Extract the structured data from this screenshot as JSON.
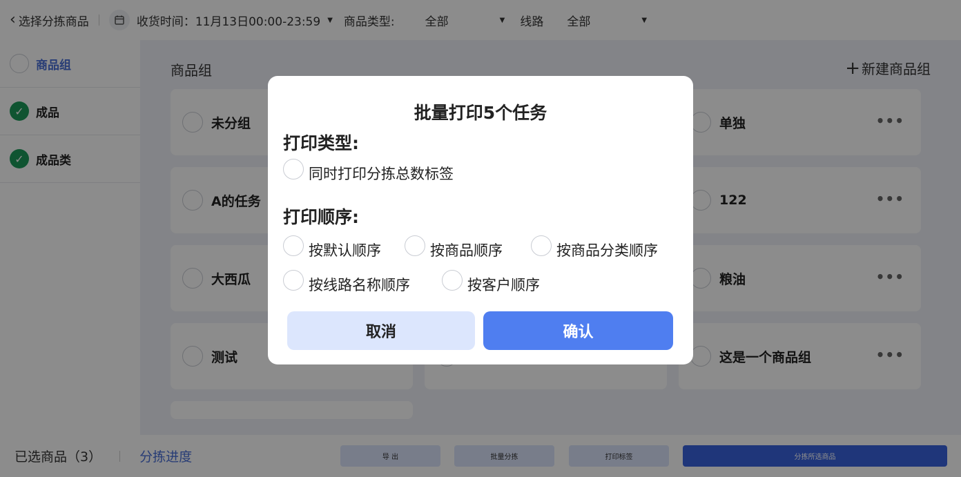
{
  "topbar": {
    "back_label": "选择分拣商品",
    "time_label": "收货时间：",
    "time_value": "11月13日00:00-23:59",
    "type_label": "商品类型:",
    "type_value": "全部",
    "route_label": "线路",
    "route_value": "全部"
  },
  "sidebar": {
    "items": [
      {
        "label": "商品组",
        "state": "unchecked",
        "active": true
      },
      {
        "label": "成品",
        "state": "checked",
        "active": false
      },
      {
        "label": "成品类",
        "state": "checked",
        "active": false
      }
    ]
  },
  "main": {
    "title": "商品组",
    "new_group_label": "新建商品组",
    "cards": [
      {
        "name": "未分组"
      },
      {
        "name": ""
      },
      {
        "name": "单独"
      },
      {
        "name": "A的任务"
      },
      {
        "name": ""
      },
      {
        "name": "122"
      },
      {
        "name": "大西瓜"
      },
      {
        "name": ""
      },
      {
        "name": "粮油"
      },
      {
        "name": "测试"
      },
      {
        "name": ""
      },
      {
        "name": "这是一个商品组"
      }
    ]
  },
  "bottombar": {
    "selected_label": "已选商品（3）",
    "progress_label": "分拣进度",
    "buttons": [
      "导 出",
      "批量分拣",
      "打印标签",
      "分拣所选商品"
    ]
  },
  "dialog": {
    "title": "批量打印5个任务",
    "print_type_title": "打印类型:",
    "print_type_option": "同时打印分拣总数标签",
    "print_order_title": "打印顺序:",
    "order_options": [
      "按默认顺序",
      "按商品顺序",
      "按商品分类顺序",
      "按线路名称顺序",
      "按客户顺序"
    ],
    "cancel_label": "取消",
    "confirm_label": "确认"
  },
  "colors": {
    "accent": "#4f7ef0",
    "accent_light": "#dce6fd",
    "checked_green": "#1d9a5a",
    "link_blue": "#4a6fd8"
  }
}
